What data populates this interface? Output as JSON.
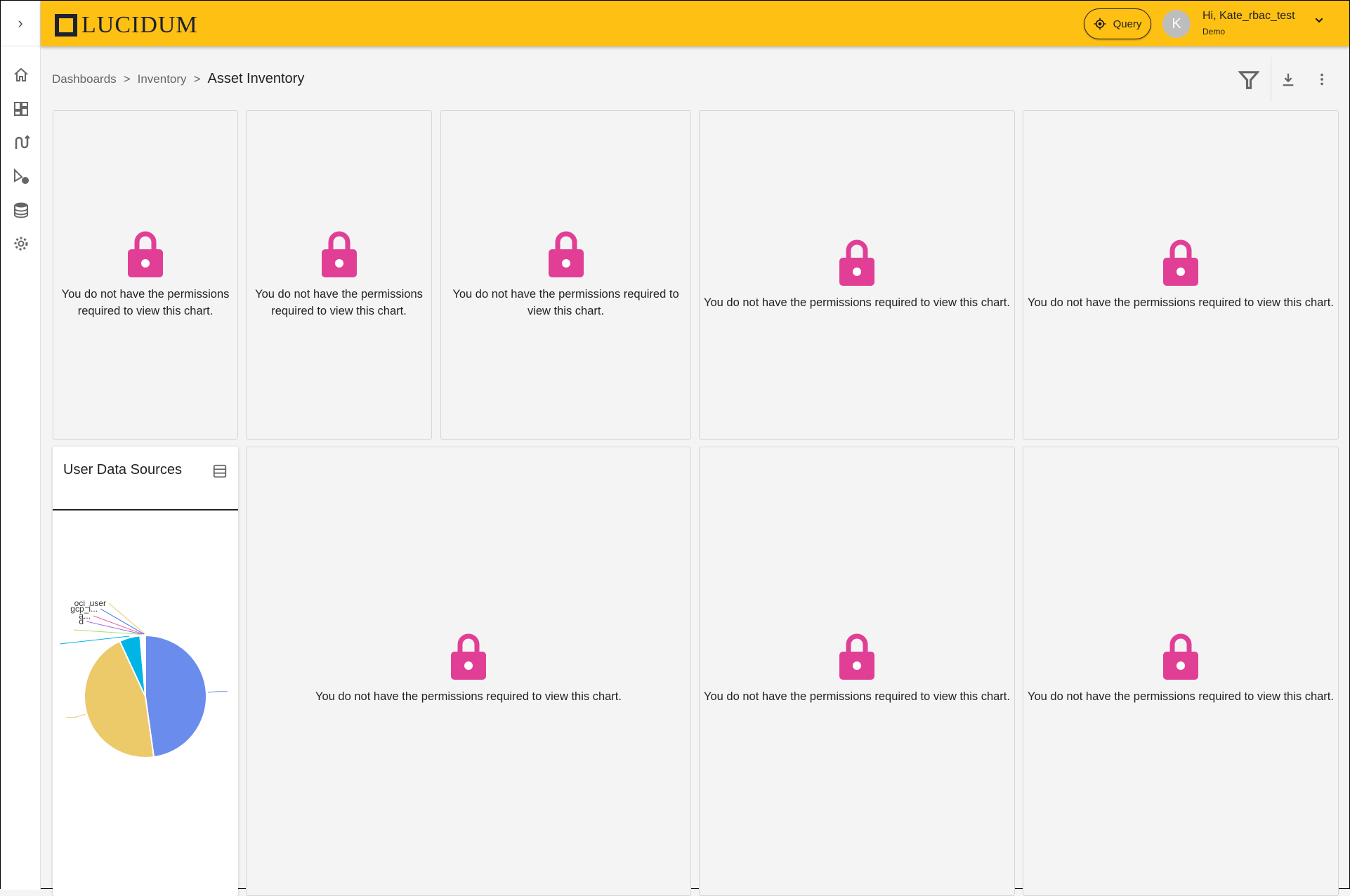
{
  "sidebar": {
    "items": [
      "home",
      "dashboards",
      "integrations",
      "queries",
      "data",
      "settings"
    ]
  },
  "header": {
    "logo": "LUCIDUM",
    "query_label": "Query",
    "avatar_initial": "K",
    "greeting": "Hi, Kate_rbac_test",
    "role": "Demo"
  },
  "breadcrumb": {
    "items": [
      "Dashboards",
      "Inventory"
    ],
    "separator": ">",
    "current": "Asset Inventory"
  },
  "locked_message": "You do not have the permissions required to view this chart.",
  "colors": {
    "header": "#fdc013",
    "lock": "#e13f96"
  },
  "widget": {
    "title": "User Data Sources"
  },
  "chart_data": {
    "type": "pie",
    "title": "User Data Sources",
    "slices": [
      {
        "label": "",
        "value": 47.8,
        "color": "#6a8cec"
      },
      {
        "label": "",
        "value": 45.3,
        "color": "#ecca6a"
      },
      {
        "label": "",
        "value": 5.5,
        "color": "#00b4e6"
      },
      {
        "label": "",
        "value": 0.3,
        "color": "#a6e07a"
      },
      {
        "label": "d",
        "value": 0.3,
        "color": "#9b6ae8"
      },
      {
        "label": "a...",
        "value": 0.3,
        "color": "#e8609e"
      },
      {
        "label": "gcp_i...",
        "value": 0.3,
        "color": "#3b6fe8"
      },
      {
        "label": "oci_user",
        "value": 0.2,
        "color": "#ecca6a"
      }
    ]
  }
}
